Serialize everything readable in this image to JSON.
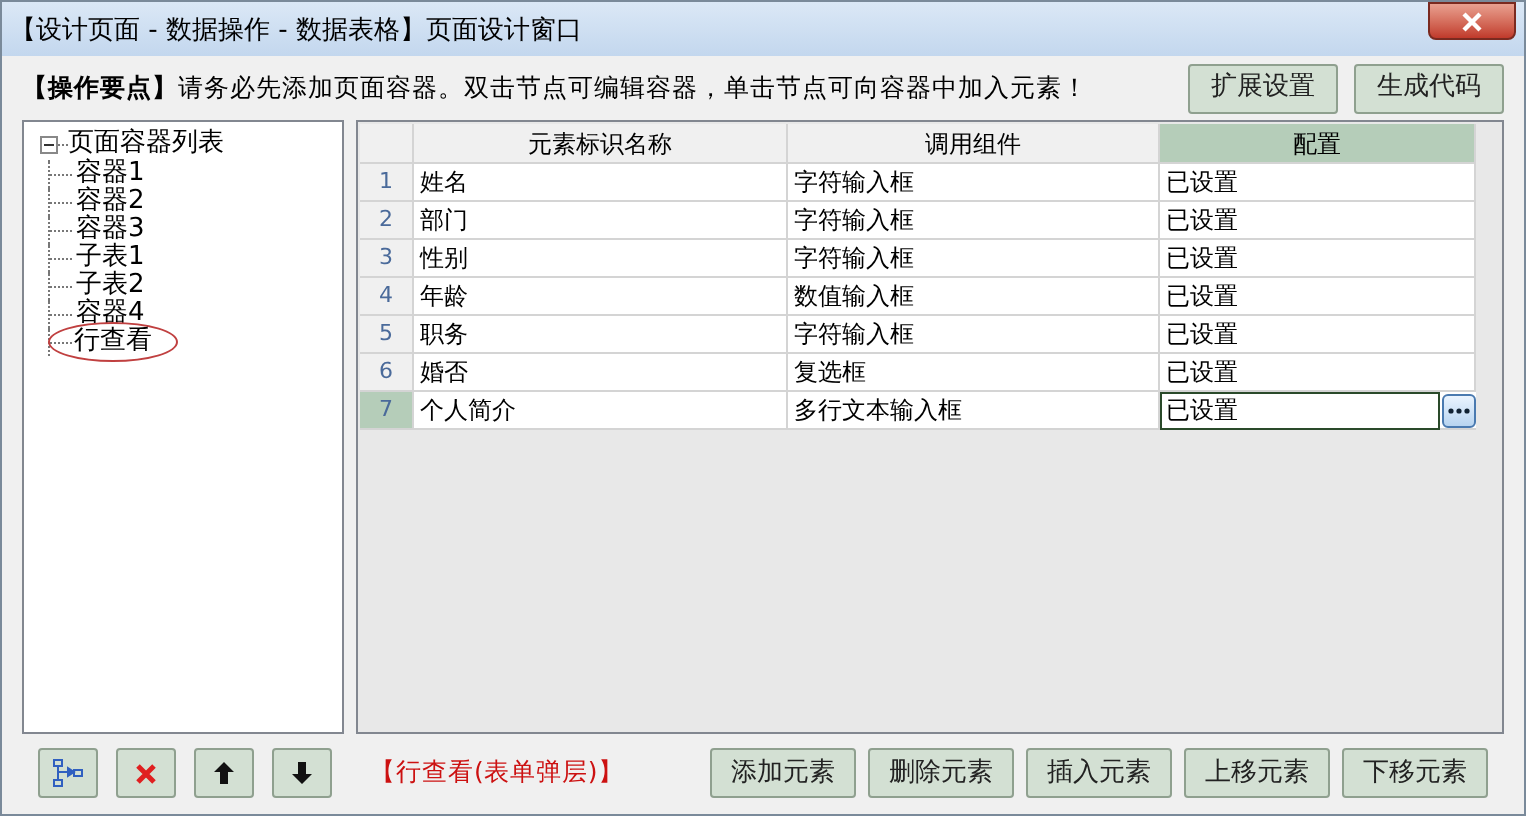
{
  "window": {
    "title": "【设计页面 - 数据操作 - 数据表格】页面设计窗口"
  },
  "tip": {
    "label": "【操作要点】",
    "text": "请务必先添加页面容器。双击节点可编辑容器，单击节点可向容器中加入元素！"
  },
  "top_buttons": [
    "扩展设置",
    "生成代码"
  ],
  "tree": {
    "label": "页面容器列表",
    "expanded": true,
    "children": [
      {
        "label": "容器1",
        "marked": false
      },
      {
        "label": "容器2",
        "marked": false
      },
      {
        "label": "容器3",
        "marked": false
      },
      {
        "label": "子表1",
        "marked": false
      },
      {
        "label": "子表2",
        "marked": false
      },
      {
        "label": "容器4",
        "marked": false
      },
      {
        "label": "行查看",
        "marked": true
      }
    ]
  },
  "table": {
    "columns": [
      "元素标识名称",
      "调用组件",
      "配置"
    ],
    "rows": [
      {
        "index": "1",
        "cells": [
          "姓名",
          "字符输入框",
          "已设置"
        ],
        "selected": false
      },
      {
        "index": "2",
        "cells": [
          "部门",
          "字符输入框",
          "已设置"
        ],
        "selected": false
      },
      {
        "index": "3",
        "cells": [
          "性别",
          "字符输入框",
          "已设置"
        ],
        "selected": false
      },
      {
        "index": "4",
        "cells": [
          "年龄",
          "数值输入框",
          "已设置"
        ],
        "selected": false
      },
      {
        "index": "5",
        "cells": [
          "职务",
          "字符输入框",
          "已设置"
        ],
        "selected": false
      },
      {
        "index": "6",
        "cells": [
          "婚否",
          "复选框",
          "已设置"
        ],
        "selected": false
      },
      {
        "index": "7",
        "cells": [
          "个人简介",
          "多行文本输入框",
          "已设置"
        ],
        "selected": true
      }
    ]
  },
  "tree_tools": [
    {
      "kind": "add"
    },
    {
      "kind": "delete"
    },
    {
      "kind": "up"
    },
    {
      "kind": "down"
    }
  ],
  "current": "【行查看(表单弹层)】",
  "bottom_buttons": [
    "添加元素",
    "删除元素",
    "插入元素",
    "上移元素",
    "下移元素"
  ]
}
